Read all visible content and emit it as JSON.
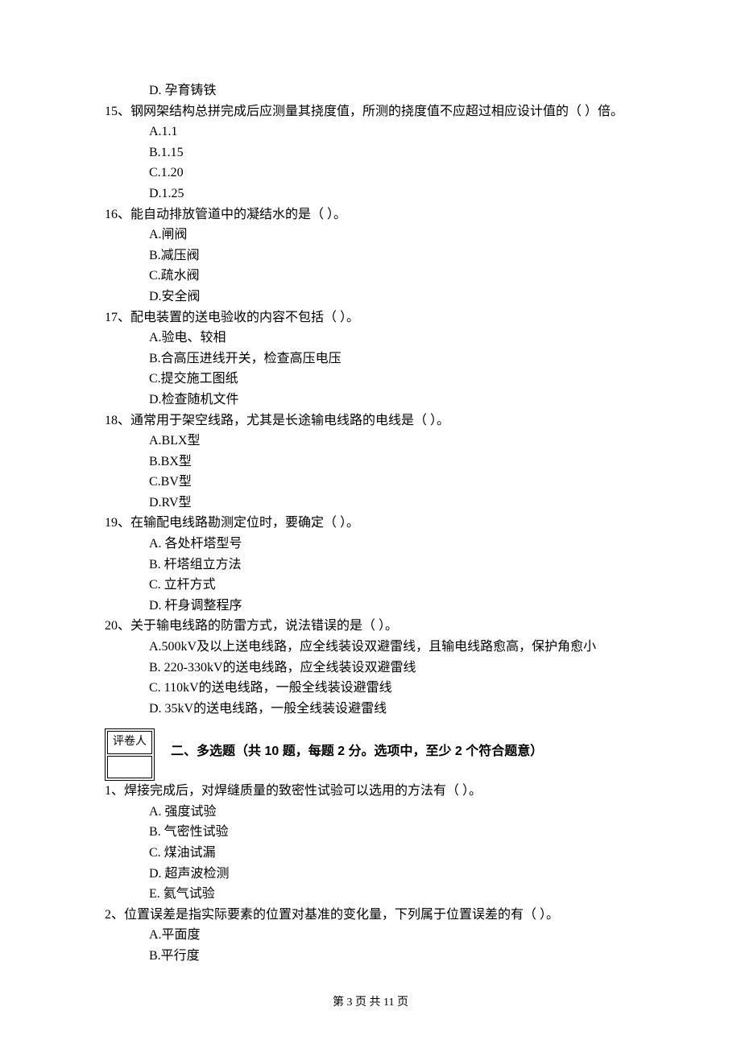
{
  "q14": {
    "optD": "D. 孕育铸铁"
  },
  "q15": {
    "stem": "15、钢网架结构总拼完成后应测量其挠度值，所测的挠度值不应超过相应设计值的（    ）倍。",
    "optA": "A.1.1",
    "optB": "B.1.15",
    "optC": "C.1.20",
    "optD": "D.1.25"
  },
  "q16": {
    "stem": "16、能自动排放管道中的凝结水的是（    ）。",
    "optA": "A.闸阀",
    "optB": "B.减压阀",
    "optC": "C.疏水阀",
    "optD": "D.安全阀"
  },
  "q17": {
    "stem": "17、配电装置的送电验收的内容不包括（    ）。",
    "optA": "A.验电、较相",
    "optB": "B.合高压进线开关，检查高压电压",
    "optC": "C.提交施工图纸",
    "optD": "D.检查随机文件"
  },
  "q18": {
    "stem": "18、通常用于架空线路，尤其是长途输电线路的电线是（    ）。",
    "optA": "A.BLX型",
    "optB": "B.BX型",
    "optC": "C.BV型",
    "optD": "D.RV型"
  },
  "q19": {
    "stem": "19、在输配电线路勘测定位时，要确定（    ）。",
    "optA": "A. 各处杆塔型号",
    "optB": "B. 杆塔组立方法",
    "optC": "C. 立杆方式",
    "optD": "D. 杆身调整程序"
  },
  "q20": {
    "stem": "20、关于输电线路的防雷方式，说法错误的是（    ）。",
    "optA": "A.500kV及以上送电线路，应全线装设双避雷线，且输电线路愈高，保护角愈小",
    "optB": "B. 220-330kV的送电线路，应全线装设双避雷线",
    "optC": "C. 110kV的送电线路，一般全线装设避雷线",
    "optD": "D. 35kV的送电线路，一般全线装设避雷线"
  },
  "scorebox": {
    "label": "评卷人"
  },
  "section2": {
    "title": "二、多选题（共 10 题，每题 2 分。选项中，至少 2 个符合题意）"
  },
  "mq1": {
    "stem": "1、焊接完成后，对焊缝质量的致密性试验可以选用的方法有（    ）。",
    "optA": "A. 强度试验",
    "optB": "B. 气密性试验",
    "optC": "C. 煤油试漏",
    "optD": "D. 超声波检测",
    "optE": "E. 氦气试验"
  },
  "mq2": {
    "stem": "2、位置误差是指实际要素的位置对基准的变化量，下列属于位置误差的有（    ）。",
    "optA": "A.平面度",
    "optB": "B.平行度"
  },
  "footer": "第 3 页 共 11 页"
}
